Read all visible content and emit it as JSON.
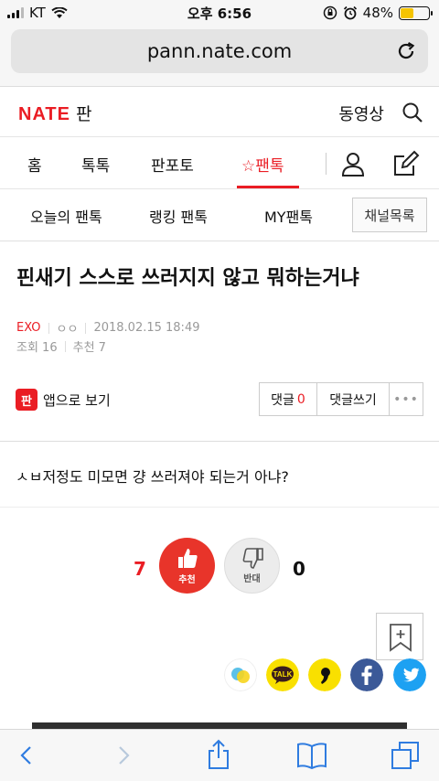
{
  "status": {
    "carrier": "KT",
    "time": "오후 6:56",
    "battery": "48%",
    "battery_level": 0.48
  },
  "browser": {
    "url": "pann.nate.com"
  },
  "header": {
    "logo": "NATE",
    "logo_suffix": "판",
    "video_link": "동영상"
  },
  "main_nav": {
    "tabs": [
      "홈",
      "톡톡",
      "판포토",
      "☆팬톡"
    ],
    "active": "☆팬톡"
  },
  "sub_nav": {
    "items": [
      "오늘의 팬톡",
      "랭킹 팬톡",
      "MY팬톡"
    ],
    "channel_button": "채널목록"
  },
  "post": {
    "title": "핀새기 스스로 쓰러지지 않고 뭐하는거냐",
    "category": "EXO",
    "author": "ㅇㅇ",
    "date": "2018.02.15 18:49",
    "views": "조회 16",
    "recommends": "추천 7",
    "app_view": "앱으로 보기",
    "app_icon_text": "판",
    "comment_label": "댓글",
    "comment_count": "0",
    "write_comment": "댓글쓰기",
    "more": "•••",
    "body": "ㅅㅂ저정도 미모면 걍 쓰러져야 되는거 아냐?"
  },
  "votes": {
    "up_count": "7",
    "up_label": "추천",
    "down_label": "반대",
    "down_count": "0"
  },
  "colors": {
    "accent": "#ea1d24",
    "ios_blue": "#2f7ce0"
  }
}
